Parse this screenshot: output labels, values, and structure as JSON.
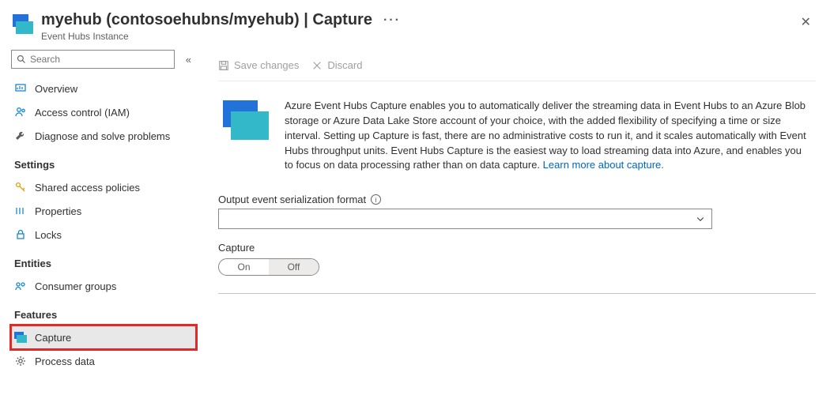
{
  "header": {
    "title": "myehub (contosoehubns/myehub) | Capture",
    "subtitle": "Event Hubs Instance"
  },
  "search": {
    "placeholder": "Search"
  },
  "sidebar": {
    "top": [
      {
        "label": "Overview",
        "icon": "overview"
      },
      {
        "label": "Access control (IAM)",
        "icon": "users"
      },
      {
        "label": "Diagnose and solve problems",
        "icon": "wrench"
      }
    ],
    "groups": [
      {
        "title": "Settings",
        "items": [
          {
            "label": "Shared access policies",
            "icon": "key"
          },
          {
            "label": "Properties",
            "icon": "properties"
          },
          {
            "label": "Locks",
            "icon": "lock"
          }
        ]
      },
      {
        "title": "Entities",
        "items": [
          {
            "label": "Consumer groups",
            "icon": "consumer"
          }
        ]
      },
      {
        "title": "Features",
        "items": [
          {
            "label": "Capture",
            "icon": "capture",
            "active": true,
            "highlighted": true
          },
          {
            "label": "Process data",
            "icon": "gear"
          }
        ]
      }
    ]
  },
  "toolbar": {
    "save": "Save changes",
    "discard": "Discard"
  },
  "intro": {
    "text": "Azure Event Hubs Capture enables you to automatically deliver the streaming data in Event Hubs to an Azure Blob storage or Azure Data Lake Store account of your choice, with the added flexibility of specifying a time or size interval. Setting up Capture is fast, there are no administrative costs to run it, and it scales automatically with Event Hubs throughput units. Event Hubs Capture is the easiest way to load streaming data into Azure, and enables you to focus on data processing rather than on data capture.",
    "link": "Learn more about capture."
  },
  "form": {
    "serialization_label": "Output event serialization format",
    "capture_label": "Capture",
    "toggle_on": "On",
    "toggle_off": "Off"
  }
}
